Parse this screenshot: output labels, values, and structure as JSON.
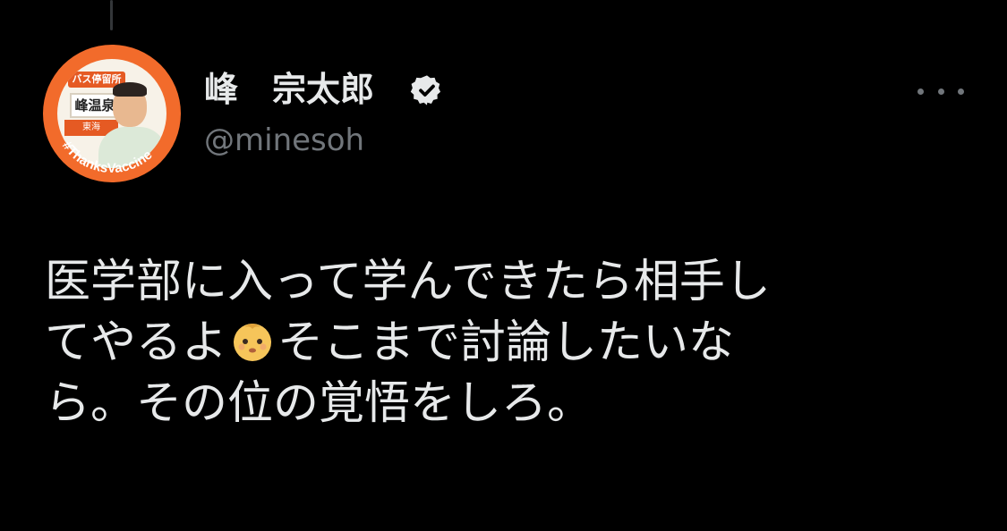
{
  "tweet": {
    "display_name": "峰　宗太郎",
    "handle": "@minesoh",
    "verified_icon": "verified-badge-icon",
    "more_icon": "more-horizontal-icon",
    "avatar": {
      "sign_top": "バス停留所",
      "sign_middle": "峰温泉",
      "sign_bottom": "東海",
      "ring_text": "#ThanksVaccine"
    },
    "text_lines": {
      "line1": "医学部に入って学んできたら相手し",
      "line2_before": "てやるよ",
      "line2_emoji": "baby-emoji",
      "line2_after": "そこまで討論したいな",
      "line3": "ら。その位の覚悟をしろ。"
    }
  },
  "colors": {
    "background": "#000000",
    "text_primary": "#e7e9ea",
    "text_secondary": "#71767b",
    "avatar_ring": "#f26b2b"
  }
}
